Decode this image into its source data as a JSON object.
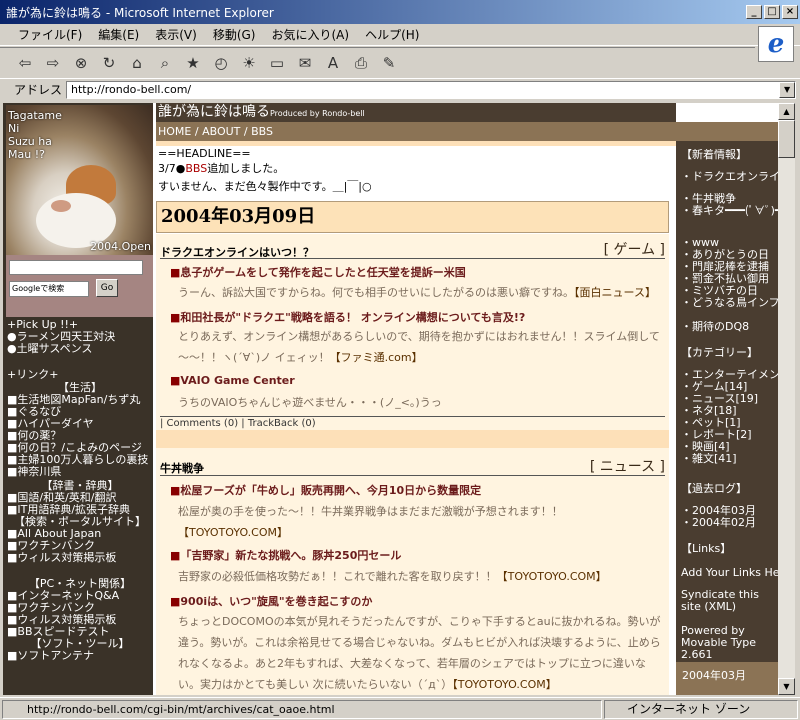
{
  "window": {
    "title": "誰が為に鈴は鳴る - Microsoft Internet Explorer"
  },
  "menu": [
    "ファイル(F)",
    "編集(E)",
    "表示(V)",
    "移動(G)",
    "お気に入り(A)",
    "ヘルプ(H)"
  ],
  "address": {
    "label": "アドレス",
    "url": "http://rondo-bell.com/"
  },
  "status": {
    "url": "http://rondo-bell.com/cgi-bin/mt/archives/cat_oaoe.html",
    "zone": "インターネット ゾーン"
  },
  "left": {
    "caption": "Tagatame\nNi\nSuzu ha\nMau !?",
    "year": "2004.Open",
    "search_select": "Googleで検索",
    "search_go": "Go",
    "pickup": [
      "+Pick Up !!+",
      "●ラーメン四天王対決",
      "●土曜サスペンス"
    ],
    "links_heading": "+リンク+",
    "life_heading": "【生活】",
    "life": [
      "■生活地図MapFan/ちず丸",
      "■ぐるなび",
      "■ハイパーダイヤ",
      "■何の薬？",
      "■何の日？/こよみのページ",
      "■主婦100万人暮らしの裏技",
      "■神奈川県"
    ],
    "dict_heading": "【辞書・辞典】",
    "dict": [
      "■国語/和英/英和/翻訳",
      "■IT用語辞典/拡張子辞典"
    ],
    "portal_heading": "【検索・ポータルサイト】",
    "portal": [
      "■All About Japan",
      "■ワクチンバンク",
      "■ウィルス対策掲示板"
    ],
    "pc_heading": "【PC・ネット関係】",
    "pc": [
      "■インターネットQ&A",
      "■ワクチンバンク",
      "■ウィルス対策掲示板",
      "■BBスピードテスト"
    ],
    "soft_heading": "【ソフト・ツール】",
    "soft": [
      "■ソフトアンテナ"
    ]
  },
  "header": {
    "title": "誰が為に鈴は鳴る",
    "produced": "Produced by Rondo-bell",
    "nav": "HOME / ABOUT / BBS"
  },
  "headline": {
    "label": "==HEADLINE==",
    "line1_date": "3/7●",
    "line1_link": "BBS",
    "line1_rest": "追加しました。",
    "line2": "すいません、まだ色々製作中です。＿|￣|○"
  },
  "date": "2004年03月09日",
  "articles": [
    {
      "title": "ドラクエオンラインはいつ！？",
      "category": "[ ゲーム ]",
      "items": [
        {
          "head": "息子がゲームをして発作を起こしたと任天堂を提訴ー米国",
          "body": "うーん、訴訟大国ですからね。何でも相手のせいにしたがるのは悪い癖ですね。",
          "link": "【面白ニュース】"
        },
        {
          "head": "和田社長が\"ドラクエ\"戦略を語る！ オンライン構想についても言及!?",
          "body": "とりあえず、オンライン構想があるらしいので、期待を抱かずにはおれません！！スライム倒して～～！！ヽ(´∀`)ノ イェィッ！",
          "link": "【ファミ通.com】"
        },
        {
          "head": "VAIO Game Center",
          "body": "うちのVAIOちゃんじゃ遊べません・・・(ノ_<。)うっ",
          "link": ""
        }
      ],
      "comments": "| Comments (0) | TrackBack (0)"
    },
    {
      "title": "牛丼戦争",
      "category": "[ ニュース ]",
      "items": [
        {
          "head": "松屋フーズが「牛めし」販売再開へ、今月10日から数量限定",
          "body": "松屋が奥の手を使った～！！牛丼業界戦争はまだまだ激戦が予想されます！！",
          "link": "【TOYOTOYO.COM】"
        },
        {
          "head": "「吉野家」新たな挑戦へ。豚丼250円セール",
          "body": "吉野家の必殺低価格攻勢だぁ！！これで離れた客を取り戻す！！",
          "link": "【TOYOTOYO.COM】"
        },
        {
          "head": "900iは、いつ\"旋風\"を巻き起こすのか",
          "body": "ちょっとDOCOMOの本気が見れそうだったんですが、こりゃ下手するとauに抜かれるね。勢いが違う。勢いが。これは余裕見せてる場合じゃないね。ダムもヒビが入れば決壊するように、止められなくなるよ。あと2年もすれば、大差なくなって、若年層のシェアではトップに立つに違いない。実力はかとても美しい 次に続いたらいない（´д`）",
          "link": "【TOYOTOYO.COM】"
        }
      ]
    }
  ],
  "right": {
    "new_heading": "【新着情報】",
    "new": [
      "・ドラクエオンラインはいつ！？",
      "・牛丼戦争",
      "・春キタ━━━(ﾟ∀ﾟ)━━━",
      "・www",
      "・ありがとうの日",
      "・門扉泥棒を逮捕",
      "・罰金不払い御用",
      "・ミツバチの日",
      "・どうなる鳥インフルエンザ",
      "・期待のDQ8"
    ],
    "cat_heading": "【カテゴリー】",
    "cats": [
      "・エンターテイメント",
      "・ゲーム[14]",
      "・ニュース[19]",
      "・ネタ[18]",
      "・ペット[1]",
      "・レポート[2]",
      "・映画[4]",
      "・雑文[41]"
    ],
    "archive_heading": "【過去ログ】",
    "archives": [
      "・2004年03月",
      "・2004年02月"
    ],
    "links_heading": "【Links】",
    "add_links": "Add Your Links Here",
    "syndicate": "Syndicate this site (XML)",
    "powered": "Powered by Movable Type 2.661",
    "calendar": "2004年03月"
  }
}
